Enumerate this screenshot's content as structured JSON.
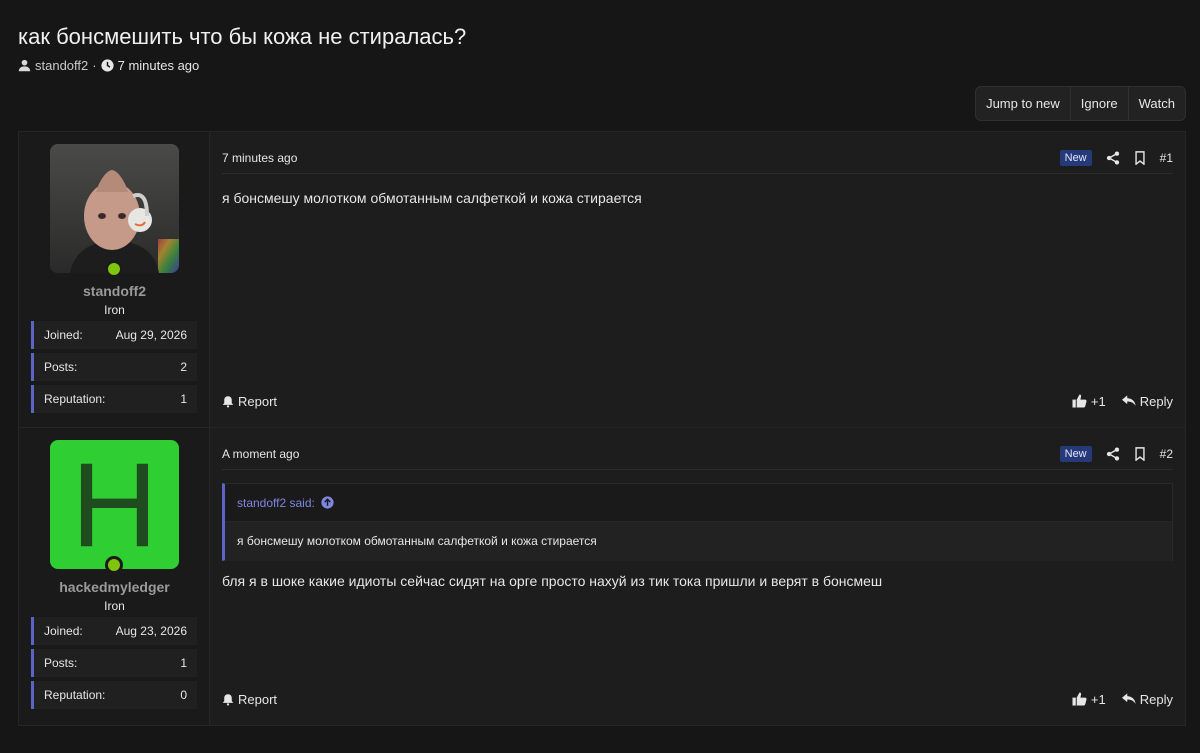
{
  "thread": {
    "title": "как бонсмешить что бы кожа не стиралась?",
    "author": "standoff2",
    "separator": "·",
    "time": "7 minutes ago"
  },
  "actions": {
    "jump": "Jump to new",
    "ignore": "Ignore",
    "watch": "Watch"
  },
  "posts": [
    {
      "user": {
        "name": "standoff2",
        "title": "Iron",
        "avatar_letter": "",
        "stats": [
          {
            "label": "Joined:",
            "value": "Aug 29, 2026"
          },
          {
            "label": "Posts:",
            "value": "2"
          },
          {
            "label": "Reputation:",
            "value": "1"
          }
        ]
      },
      "time": "7 minutes ago",
      "badge": "New",
      "number": "#1",
      "body": "я бонсмешу молотком обмотанным салфеткой и кожа стирается",
      "report": "Report",
      "like": "+1",
      "reply": "Reply"
    },
    {
      "user": {
        "name": "hackedmyledger",
        "title": "Iron",
        "avatar_letter": "H",
        "stats": [
          {
            "label": "Joined:",
            "value": "Aug 23, 2026"
          },
          {
            "label": "Posts:",
            "value": "1"
          },
          {
            "label": "Reputation:",
            "value": "0"
          }
        ]
      },
      "time": "A moment ago",
      "badge": "New",
      "number": "#2",
      "quote": {
        "author_said": "standoff2 said:",
        "text": "я бонсмешу молотком обмотанным салфеткой и кожа стирается"
      },
      "body": "бля я в шоке какие идиоты сейчас сидят на орге просто нахуй из тик тока пришли и верят в бонсмеш",
      "report": "Report",
      "like": "+1",
      "reply": "Reply"
    }
  ]
}
